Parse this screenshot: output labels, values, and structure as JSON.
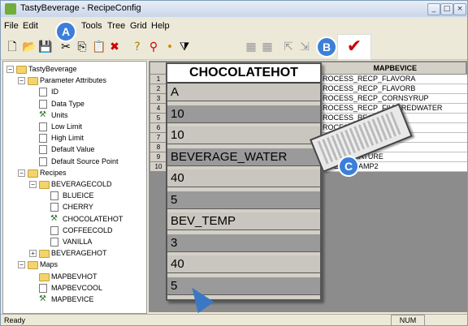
{
  "window": {
    "title": "TastyBeverage - RecipeConfig"
  },
  "menu": [
    "File",
    "Edit",
    "Tools",
    "Tree",
    "Grid",
    "Help"
  ],
  "annotations": {
    "a": "A",
    "b": "B",
    "c": "C"
  },
  "tree": [
    {
      "label": "TastyBeverage",
      "icon": "folder",
      "level": 0,
      "expander": "−"
    },
    {
      "label": "Parameter Attributes",
      "icon": "folder",
      "level": 1,
      "expander": "−"
    },
    {
      "label": "ID",
      "icon": "page",
      "level": 2
    },
    {
      "label": "Data Type",
      "icon": "page",
      "level": 2
    },
    {
      "label": "Units",
      "icon": "tool",
      "level": 2
    },
    {
      "label": "Low Limit",
      "icon": "page",
      "level": 2
    },
    {
      "label": "High Limit",
      "icon": "page",
      "level": 2
    },
    {
      "label": "Default Value",
      "icon": "page",
      "level": 2
    },
    {
      "label": "Default Source Point",
      "icon": "page",
      "level": 2
    },
    {
      "label": "Recipes",
      "icon": "folder",
      "level": 1,
      "expander": "−"
    },
    {
      "label": "BEVERAGECOLD",
      "icon": "folder",
      "level": 2,
      "expander": "−"
    },
    {
      "label": "BLUEICE",
      "icon": "page",
      "level": 3
    },
    {
      "label": "CHERRY",
      "icon": "page",
      "level": 3
    },
    {
      "label": "CHOCOLATEHOT",
      "icon": "tool",
      "level": 3
    },
    {
      "label": "COFFEECOLD",
      "icon": "page",
      "level": 3
    },
    {
      "label": "VANILLA",
      "icon": "page",
      "level": 3
    },
    {
      "label": "BEVERAGEHOT",
      "icon": "folder",
      "level": 2,
      "expander": "+"
    },
    {
      "label": "Maps",
      "icon": "folder",
      "level": 1,
      "expander": "−"
    },
    {
      "label": "MAPBEVHOT",
      "icon": "folder",
      "level": 2
    },
    {
      "label": "MAPBEVCOOL",
      "icon": "page",
      "level": 2
    },
    {
      "label": "MAPBEVICE",
      "icon": "tool",
      "level": 2
    }
  ],
  "grid": {
    "column_header": "MAPBEVICE",
    "rows": [
      {
        "num": "1",
        "value": "ROCESS_RECP_FLAVORA"
      },
      {
        "num": "2",
        "value": "ROCESS_RECP_FLAVORB"
      },
      {
        "num": "3",
        "value": "ROCESS_RECP_CORNSYRUP"
      },
      {
        "num": "4",
        "value": "ROCESS_RECP_FILTEREDWATER"
      },
      {
        "num": "5",
        "value": "ROCESS_RECP_STA..."
      },
      {
        "num": "6",
        "value": "ROCESS_RECP..."
      },
      {
        "num": "7",
        "value": "ROCESS_..."
      },
      {
        "num": "8",
        "value": ""
      },
      {
        "num": "9",
        "value": "...TEMPERATURE"
      },
      {
        "num": "10",
        "value": "...RECP_RAMP2"
      }
    ]
  },
  "popup": {
    "title": "CHOCOLATEHOT",
    "cells": [
      "A",
      "10",
      "10",
      "BEVERAGE_WATER",
      "40",
      "5",
      "BEV_TEMP",
      "3",
      "40",
      "5"
    ]
  },
  "status": {
    "left": "Ready",
    "num": "NUM"
  }
}
